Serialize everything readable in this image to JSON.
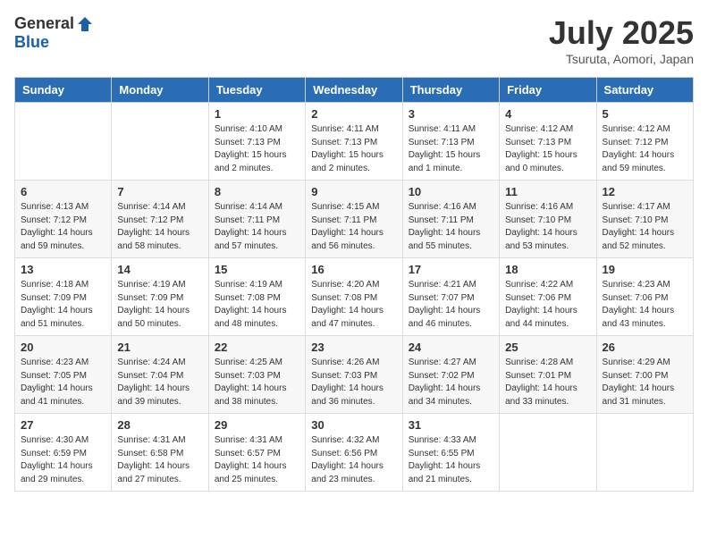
{
  "logo": {
    "general": "General",
    "blue": "Blue"
  },
  "title": "July 2025",
  "location": "Tsuruta, Aomori, Japan",
  "headers": [
    "Sunday",
    "Monday",
    "Tuesday",
    "Wednesday",
    "Thursday",
    "Friday",
    "Saturday"
  ],
  "weeks": [
    [
      {
        "day": "",
        "info": ""
      },
      {
        "day": "",
        "info": ""
      },
      {
        "day": "1",
        "info": "Sunrise: 4:10 AM\nSunset: 7:13 PM\nDaylight: 15 hours\nand 2 minutes."
      },
      {
        "day": "2",
        "info": "Sunrise: 4:11 AM\nSunset: 7:13 PM\nDaylight: 15 hours\nand 2 minutes."
      },
      {
        "day": "3",
        "info": "Sunrise: 4:11 AM\nSunset: 7:13 PM\nDaylight: 15 hours\nand 1 minute."
      },
      {
        "day": "4",
        "info": "Sunrise: 4:12 AM\nSunset: 7:13 PM\nDaylight: 15 hours\nand 0 minutes."
      },
      {
        "day": "5",
        "info": "Sunrise: 4:12 AM\nSunset: 7:12 PM\nDaylight: 14 hours\nand 59 minutes."
      }
    ],
    [
      {
        "day": "6",
        "info": "Sunrise: 4:13 AM\nSunset: 7:12 PM\nDaylight: 14 hours\nand 59 minutes."
      },
      {
        "day": "7",
        "info": "Sunrise: 4:14 AM\nSunset: 7:12 PM\nDaylight: 14 hours\nand 58 minutes."
      },
      {
        "day": "8",
        "info": "Sunrise: 4:14 AM\nSunset: 7:11 PM\nDaylight: 14 hours\nand 57 minutes."
      },
      {
        "day": "9",
        "info": "Sunrise: 4:15 AM\nSunset: 7:11 PM\nDaylight: 14 hours\nand 56 minutes."
      },
      {
        "day": "10",
        "info": "Sunrise: 4:16 AM\nSunset: 7:11 PM\nDaylight: 14 hours\nand 55 minutes."
      },
      {
        "day": "11",
        "info": "Sunrise: 4:16 AM\nSunset: 7:10 PM\nDaylight: 14 hours\nand 53 minutes."
      },
      {
        "day": "12",
        "info": "Sunrise: 4:17 AM\nSunset: 7:10 PM\nDaylight: 14 hours\nand 52 minutes."
      }
    ],
    [
      {
        "day": "13",
        "info": "Sunrise: 4:18 AM\nSunset: 7:09 PM\nDaylight: 14 hours\nand 51 minutes."
      },
      {
        "day": "14",
        "info": "Sunrise: 4:19 AM\nSunset: 7:09 PM\nDaylight: 14 hours\nand 50 minutes."
      },
      {
        "day": "15",
        "info": "Sunrise: 4:19 AM\nSunset: 7:08 PM\nDaylight: 14 hours\nand 48 minutes."
      },
      {
        "day": "16",
        "info": "Sunrise: 4:20 AM\nSunset: 7:08 PM\nDaylight: 14 hours\nand 47 minutes."
      },
      {
        "day": "17",
        "info": "Sunrise: 4:21 AM\nSunset: 7:07 PM\nDaylight: 14 hours\nand 46 minutes."
      },
      {
        "day": "18",
        "info": "Sunrise: 4:22 AM\nSunset: 7:06 PM\nDaylight: 14 hours\nand 44 minutes."
      },
      {
        "day": "19",
        "info": "Sunrise: 4:23 AM\nSunset: 7:06 PM\nDaylight: 14 hours\nand 43 minutes."
      }
    ],
    [
      {
        "day": "20",
        "info": "Sunrise: 4:23 AM\nSunset: 7:05 PM\nDaylight: 14 hours\nand 41 minutes."
      },
      {
        "day": "21",
        "info": "Sunrise: 4:24 AM\nSunset: 7:04 PM\nDaylight: 14 hours\nand 39 minutes."
      },
      {
        "day": "22",
        "info": "Sunrise: 4:25 AM\nSunset: 7:03 PM\nDaylight: 14 hours\nand 38 minutes."
      },
      {
        "day": "23",
        "info": "Sunrise: 4:26 AM\nSunset: 7:03 PM\nDaylight: 14 hours\nand 36 minutes."
      },
      {
        "day": "24",
        "info": "Sunrise: 4:27 AM\nSunset: 7:02 PM\nDaylight: 14 hours\nand 34 minutes."
      },
      {
        "day": "25",
        "info": "Sunrise: 4:28 AM\nSunset: 7:01 PM\nDaylight: 14 hours\nand 33 minutes."
      },
      {
        "day": "26",
        "info": "Sunrise: 4:29 AM\nSunset: 7:00 PM\nDaylight: 14 hours\nand 31 minutes."
      }
    ],
    [
      {
        "day": "27",
        "info": "Sunrise: 4:30 AM\nSunset: 6:59 PM\nDaylight: 14 hours\nand 29 minutes."
      },
      {
        "day": "28",
        "info": "Sunrise: 4:31 AM\nSunset: 6:58 PM\nDaylight: 14 hours\nand 27 minutes."
      },
      {
        "day": "29",
        "info": "Sunrise: 4:31 AM\nSunset: 6:57 PM\nDaylight: 14 hours\nand 25 minutes."
      },
      {
        "day": "30",
        "info": "Sunrise: 4:32 AM\nSunset: 6:56 PM\nDaylight: 14 hours\nand 23 minutes."
      },
      {
        "day": "31",
        "info": "Sunrise: 4:33 AM\nSunset: 6:55 PM\nDaylight: 14 hours\nand 21 minutes."
      },
      {
        "day": "",
        "info": ""
      },
      {
        "day": "",
        "info": ""
      }
    ]
  ]
}
